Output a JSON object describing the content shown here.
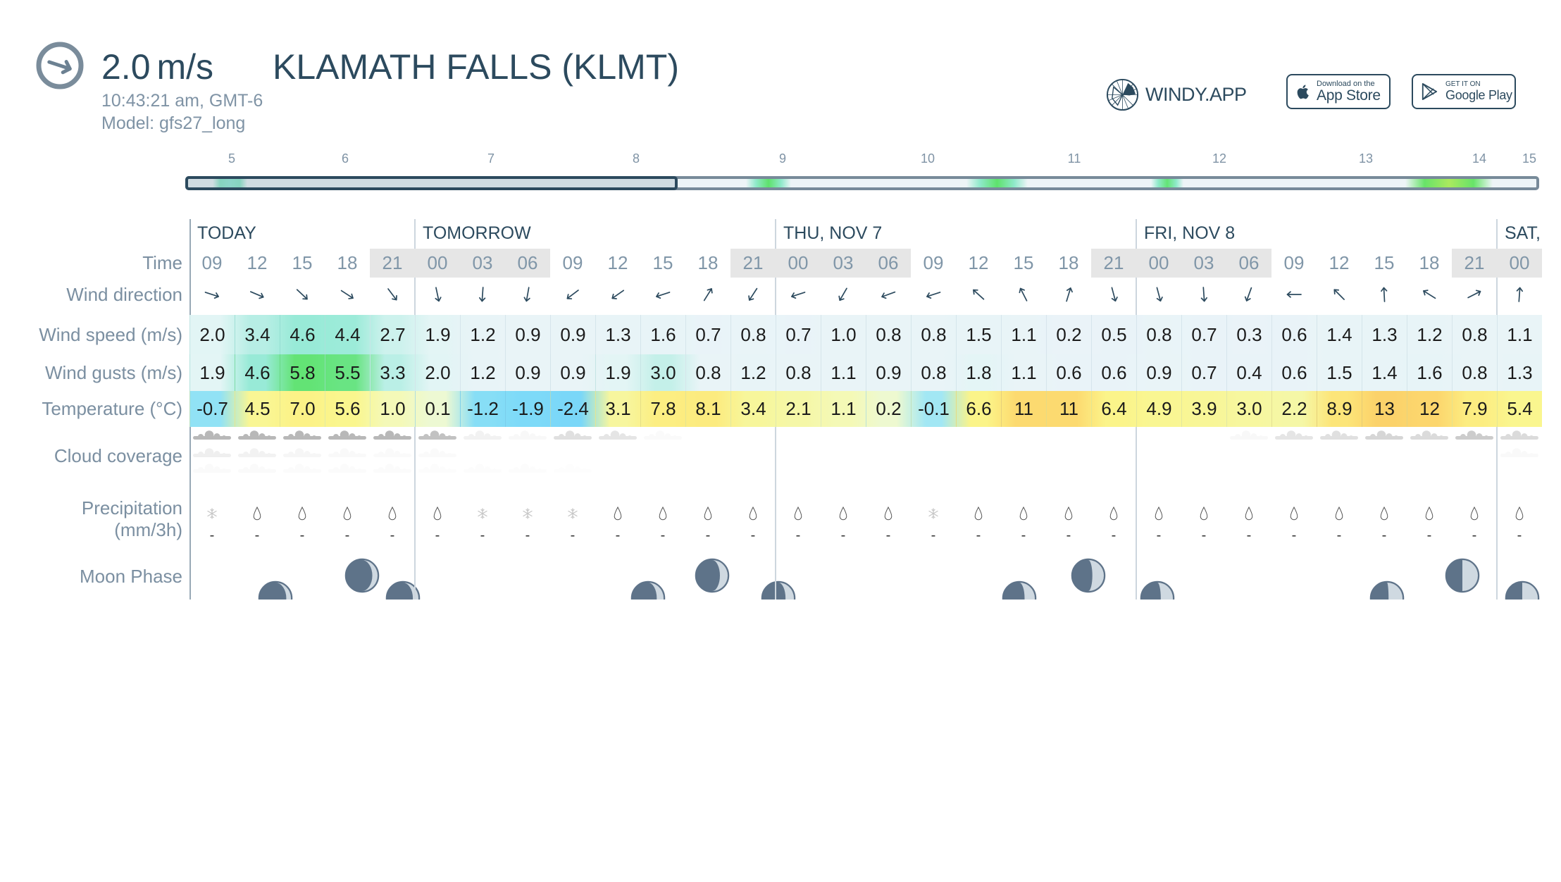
{
  "header": {
    "wind_speed": "2.0",
    "wind_unit": "m/s",
    "wind_direction_deg": 108,
    "station": "KLAMATH FALLS (KLMT)",
    "local_time": "10:43:21 am, GMT-6",
    "model": "Model: gfs27_long"
  },
  "branding": {
    "logo_text": "WINDY.APP",
    "app_store": {
      "small": "Download on the",
      "big": "App Store"
    },
    "google_play": {
      "small": "GET IT ON",
      "big": "Google Play"
    }
  },
  "colors": {
    "accent": "#2c4a5e",
    "muted_text": "#7b8fa1",
    "night_shading": "#e6e6e6",
    "moon_dark": "#5e7389",
    "moon_lit": "#cfd9e1"
  },
  "timeline": {
    "day_labels": [
      "5",
      "6",
      "7",
      "8",
      "9",
      "10",
      "11",
      "12",
      "13",
      "14",
      "15"
    ],
    "range_days": {
      "start": 0.403,
      "end": 9.69
    },
    "selected_days": {
      "start": 0.403,
      "end": 3.78
    },
    "wind_highlights": [
      {
        "from": 0.59,
        "to": 0.83,
        "peak_ms": 4.6
      },
      {
        "from": 4.25,
        "to": 4.56,
        "peak_ms": 6.0
      },
      {
        "from": 5.76,
        "to": 6.18,
        "peak_ms": 6.0
      },
      {
        "from": 7.03,
        "to": 7.25,
        "peak_ms": 5.8
      },
      {
        "from": 8.77,
        "to": 9.37,
        "peak_ms": 7.6
      }
    ]
  },
  "table": {
    "row_labels": {
      "time": "Time",
      "wind_direction": "Wind direction",
      "wind_speed": "Wind speed (m/s)",
      "wind_gusts": "Wind gusts (m/s)",
      "temperature": "Temperature (°C)",
      "cloud_coverage": "Cloud coverage",
      "precipitation": "Precipitation",
      "precipitation_unit": "(mm/3h)",
      "moon_phase": "Moon Phase"
    },
    "days": [
      {
        "label": "TODAY",
        "columns": 5
      },
      {
        "label": "TOMORROW",
        "columns": 8
      },
      {
        "label": "THU, NOV 7",
        "columns": 8
      },
      {
        "label": "FRI, NOV 8",
        "columns": 8
      },
      {
        "label": "SAT,",
        "columns": 1
      }
    ],
    "columns": [
      {
        "time": "09",
        "night": false,
        "dir": 108,
        "speed": "2.0",
        "gust": "1.9",
        "temp": "-0.7",
        "cloud": [
          70,
          15,
          4
        ],
        "precip_icon": "snow",
        "precip": "-"
      },
      {
        "time": "12",
        "night": false,
        "dir": 113,
        "speed": "3.4",
        "gust": "4.6",
        "temp": "4.5",
        "cloud": [
          70,
          12,
          4
        ],
        "precip_icon": "rain",
        "precip": "-"
      },
      {
        "time": "15",
        "night": false,
        "dir": 133,
        "speed": "4.6",
        "gust": "5.8",
        "temp": "7.0",
        "cloud": [
          70,
          8,
          3
        ],
        "precip_icon": "rain",
        "precip": "-"
      },
      {
        "time": "18",
        "night": false,
        "dir": 123,
        "speed": "4.4",
        "gust": "5.5",
        "temp": "5.6",
        "cloud": [
          70,
          5,
          3
        ],
        "precip_icon": "rain",
        "precip": "-"
      },
      {
        "time": "21",
        "night": true,
        "dir": 143,
        "speed": "2.7",
        "gust": "3.3",
        "temp": "1.0",
        "cloud": [
          70,
          4,
          3
        ],
        "precip_icon": "rain",
        "precip": "-"
      },
      {
        "time": "00",
        "night": true,
        "dir": 168,
        "speed": "1.9",
        "gust": "2.0",
        "temp": "0.1",
        "cloud": [
          60,
          4,
          2
        ],
        "precip_icon": "rain",
        "precip": "-"
      },
      {
        "time": "03",
        "night": true,
        "dir": 184,
        "speed": "1.2",
        "gust": "1.2",
        "temp": "-1.2",
        "cloud": [
          12,
          0,
          2
        ],
        "precip_icon": "snow",
        "precip": "-"
      },
      {
        "time": "06",
        "night": true,
        "dir": 190,
        "speed": "0.9",
        "gust": "0.9",
        "temp": "-1.9",
        "cloud": [
          6,
          0,
          2
        ],
        "precip_icon": "snow",
        "precip": "-"
      },
      {
        "time": "09",
        "night": false,
        "dir": 233,
        "speed": "0.9",
        "gust": "0.9",
        "temp": "-2.4",
        "cloud": [
          30,
          0,
          1
        ],
        "precip_icon": "snow",
        "precip": "-"
      },
      {
        "time": "12",
        "night": false,
        "dir": 235,
        "speed": "1.3",
        "gust": "1.9",
        "temp": "3.1",
        "cloud": [
          25,
          0,
          0
        ],
        "precip_icon": "rain",
        "precip": "-"
      },
      {
        "time": "15",
        "night": false,
        "dir": 252,
        "speed": "1.6",
        "gust": "3.0",
        "temp": "7.8",
        "cloud": [
          4,
          0,
          0
        ],
        "precip_icon": "rain",
        "precip": "-"
      },
      {
        "time": "18",
        "night": false,
        "dir": 32,
        "speed": "0.7",
        "gust": "0.8",
        "temp": "8.1",
        "cloud": [
          0,
          0,
          0
        ],
        "precip_icon": "rain",
        "precip": "-"
      },
      {
        "time": "21",
        "night": true,
        "dir": 213,
        "speed": "0.8",
        "gust": "1.2",
        "temp": "3.4",
        "cloud": [
          0,
          0,
          0
        ],
        "precip_icon": "rain",
        "precip": "-"
      },
      {
        "time": "00",
        "night": true,
        "dir": 252,
        "speed": "0.7",
        "gust": "0.8",
        "temp": "2.1",
        "cloud": [
          0,
          0,
          0
        ],
        "precip_icon": "rain",
        "precip": "-"
      },
      {
        "time": "03",
        "night": true,
        "dir": 210,
        "speed": "1.0",
        "gust": "1.1",
        "temp": "1.1",
        "cloud": [
          0,
          0,
          0
        ],
        "precip_icon": "rain",
        "precip": "-"
      },
      {
        "time": "06",
        "night": true,
        "dir": 250,
        "speed": "0.8",
        "gust": "0.9",
        "temp": "0.2",
        "cloud": [
          0,
          0,
          0
        ],
        "precip_icon": "rain",
        "precip": "-"
      },
      {
        "time": "09",
        "night": false,
        "dir": 252,
        "speed": "0.8",
        "gust": "0.8",
        "temp": "-0.1",
        "cloud": [
          0,
          0,
          0
        ],
        "precip_icon": "snow",
        "precip": "-"
      },
      {
        "time": "12",
        "night": false,
        "dir": 312,
        "speed": "1.5",
        "gust": "1.8",
        "temp": "6.6",
        "cloud": [
          0,
          0,
          0
        ],
        "precip_icon": "rain",
        "precip": "-"
      },
      {
        "time": "15",
        "night": false,
        "dir": 333,
        "speed": "1.1",
        "gust": "1.1",
        "temp": "11",
        "cloud": [
          0,
          0,
          0
        ],
        "precip_icon": "rain",
        "precip": "-"
      },
      {
        "time": "18",
        "night": false,
        "dir": 17,
        "speed": "0.2",
        "gust": "0.6",
        "temp": "11",
        "cloud": [
          0,
          0,
          0
        ],
        "precip_icon": "rain",
        "precip": "-"
      },
      {
        "time": "21",
        "night": true,
        "dir": 165,
        "speed": "0.5",
        "gust": "0.6",
        "temp": "6.4",
        "cloud": [
          0,
          0,
          0
        ],
        "precip_icon": "rain",
        "precip": "-"
      },
      {
        "time": "00",
        "night": true,
        "dir": 165,
        "speed": "0.8",
        "gust": "0.9",
        "temp": "4.9",
        "cloud": [
          0,
          0,
          0
        ],
        "precip_icon": "rain",
        "precip": "-"
      },
      {
        "time": "03",
        "night": true,
        "dir": 176,
        "speed": "0.7",
        "gust": "0.7",
        "temp": "3.9",
        "cloud": [
          0,
          0,
          0
        ],
        "precip_icon": "rain",
        "precip": "-"
      },
      {
        "time": "06",
        "night": true,
        "dir": 200,
        "speed": "0.3",
        "gust": "0.4",
        "temp": "3.0",
        "cloud": [
          6,
          0,
          0
        ],
        "precip_icon": "rain",
        "precip": "-"
      },
      {
        "time": "09",
        "night": false,
        "dir": 270,
        "speed": "0.6",
        "gust": "0.6",
        "temp": "2.2",
        "cloud": [
          25,
          0,
          0
        ],
        "precip_icon": "rain",
        "precip": "-"
      },
      {
        "time": "12",
        "night": false,
        "dir": 315,
        "speed": "1.4",
        "gust": "1.5",
        "temp": "8.9",
        "cloud": [
          30,
          0,
          0
        ],
        "precip_icon": "rain",
        "precip": "-"
      },
      {
        "time": "15",
        "night": false,
        "dir": 357,
        "speed": "1.3",
        "gust": "1.4",
        "temp": "13",
        "cloud": [
          40,
          0,
          0
        ],
        "precip_icon": "rain",
        "precip": "-"
      },
      {
        "time": "18",
        "night": false,
        "dir": 302,
        "speed": "1.2",
        "gust": "1.6",
        "temp": "12",
        "cloud": [
          35,
          0,
          0
        ],
        "precip_icon": "rain",
        "precip": "-"
      },
      {
        "time": "21",
        "night": true,
        "dir": 63,
        "speed": "0.8",
        "gust": "0.8",
        "temp": "7.9",
        "cloud": [
          50,
          0,
          0
        ],
        "precip_icon": "rain",
        "precip": "-"
      },
      {
        "time": "00",
        "night": true,
        "dir": 4,
        "speed": "1.1",
        "gust": "1.3",
        "temp": "5.4",
        "cloud": [
          35,
          5,
          0
        ],
        "precip_icon": "rain",
        "precip": "-"
      }
    ]
  },
  "moon": [
    {
      "day_index": 0,
      "hour": 13.2,
      "altitude": 0,
      "illumination": 0.15
    },
    {
      "day_index": 0,
      "hour": 19.0,
      "altitude": 1,
      "illumination": 0.17
    },
    {
      "day_index": 0,
      "hour": 21.7,
      "altitude": 0,
      "illumination": 0.18
    },
    {
      "day_index": 1,
      "hour": 14.0,
      "altitude": 0,
      "illumination": 0.22
    },
    {
      "day_index": 1,
      "hour": 18.3,
      "altitude": 1,
      "illumination": 0.25
    },
    {
      "day_index": 1,
      "hour": 22.7,
      "altitude": 0,
      "illumination": 0.27
    },
    {
      "day_index": 2,
      "hour": 14.7,
      "altitude": 0,
      "illumination": 0.33
    },
    {
      "day_index": 2,
      "hour": 19.3,
      "altitude": 1,
      "illumination": 0.37
    },
    {
      "day_index": 2,
      "hour": 23.9,
      "altitude": 0,
      "illumination": 0.39
    },
    {
      "day_index": 3,
      "hour": 15.2,
      "altitude": 0,
      "illumination": 0.45
    },
    {
      "day_index": 3,
      "hour": 20.2,
      "altitude": 1,
      "illumination": 0.5
    },
    {
      "day_index": 4,
      "hour": 0.2,
      "altitude": 0,
      "illumination": 0.5
    }
  ]
}
